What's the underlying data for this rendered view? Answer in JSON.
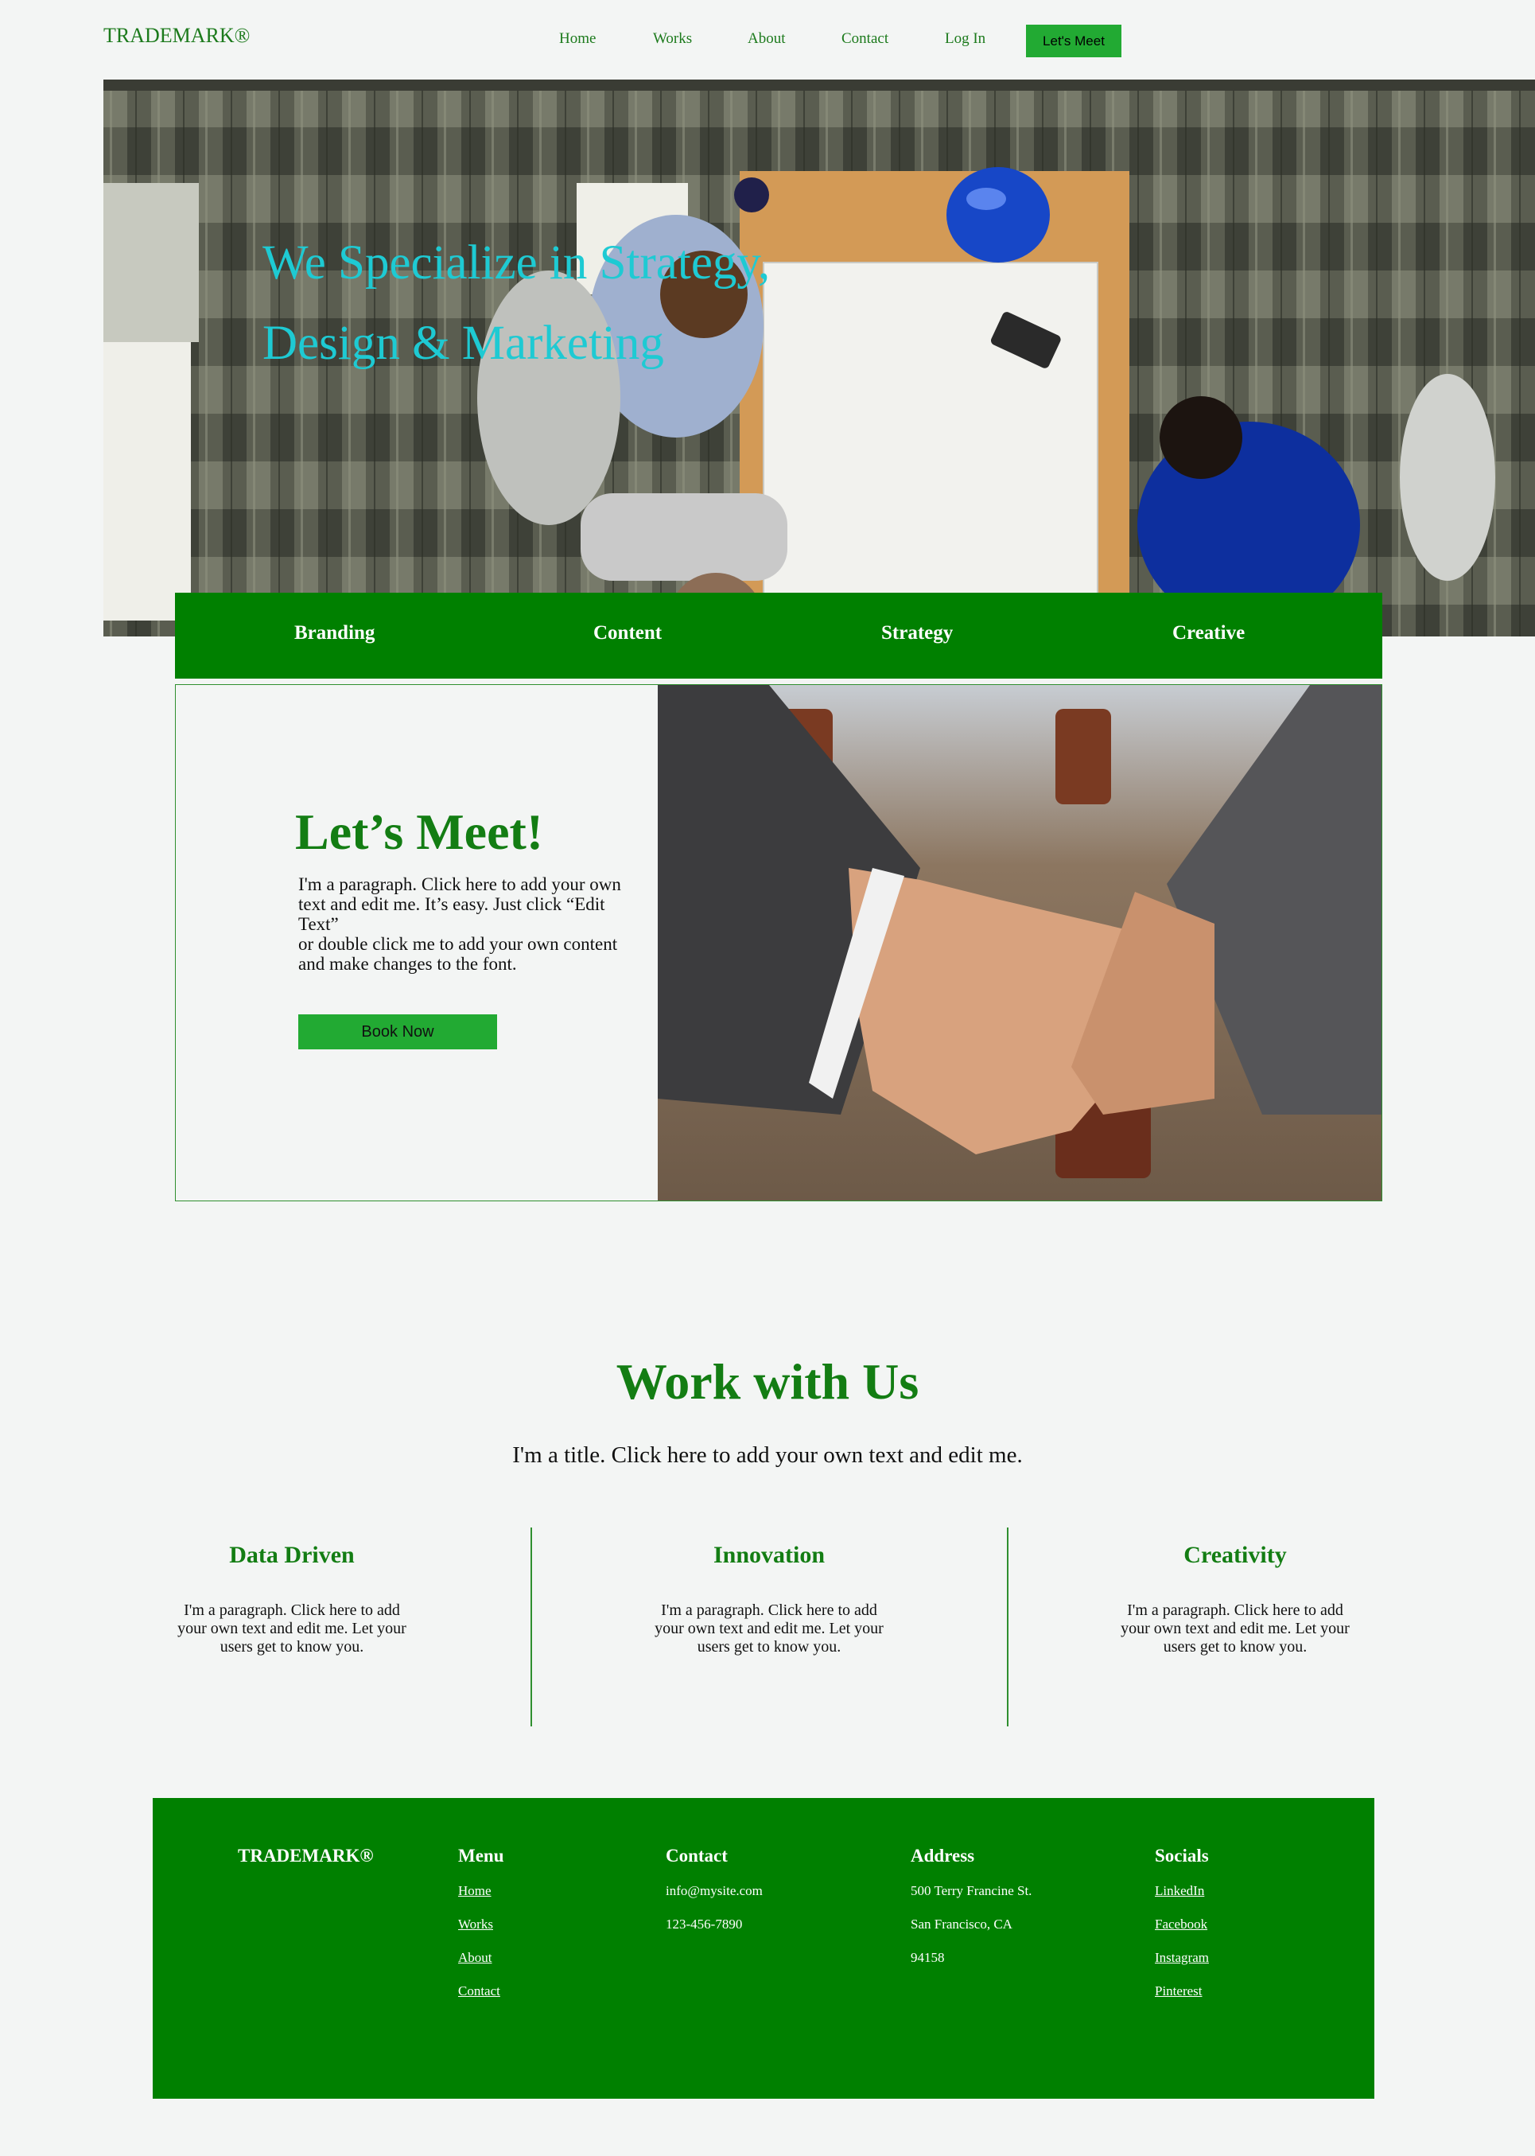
{
  "header": {
    "brand": "TRADEMARK®",
    "nav": [
      "Home",
      "Works",
      "About",
      "Contact",
      "Log In"
    ],
    "cta": "Let's Meet"
  },
  "hero": {
    "title_line1": "We Specialize in Strategy,",
    "title_line2": "Design & Marketing"
  },
  "services": [
    "Branding",
    "Content",
    "Strategy",
    "Creative"
  ],
  "meet": {
    "title": "Let’s Meet!",
    "para1": "I'm a paragraph. Click here to add your own text and edit me. It’s easy. Just click “Edit Text”",
    "para2": "or double click me to add your own content and make changes to the font.",
    "button": "Book Now"
  },
  "work": {
    "title": "Work with Us",
    "subtitle": "I'm a title. Click here to add your own text and edit me.",
    "columns": [
      {
        "title": "Data Driven",
        "text": "I'm a paragraph. Click here to add your own text and edit me. Let your users get to know you."
      },
      {
        "title": "Innovation",
        "text": "I'm a paragraph. Click here to add your own text and edit me. Let your users get to know you."
      },
      {
        "title": "Creativity",
        "text": "I'm a paragraph. Click here to add your own text and edit me. Let your users get to know you."
      }
    ]
  },
  "footer": {
    "brand": "TRADEMARK®",
    "menu_heading": "Menu",
    "menu": [
      "Home",
      "Works",
      "About",
      "Contact"
    ],
    "contact_heading": "Contact",
    "contact": [
      "info@mysite.com",
      "123-456-7890"
    ],
    "address_heading": "Address",
    "address": [
      "500 Terry Francine St.",
      "San Francisco, CA",
      "94158"
    ],
    "socials_heading": "Socials",
    "socials": [
      "LinkedIn",
      "Facebook",
      "Instagram",
      "Pinterest"
    ]
  },
  "colors": {
    "brand_green": "#008000",
    "button_green": "#22aa33",
    "hero_text": "#1ecad3",
    "background": "#f3f5f4"
  }
}
